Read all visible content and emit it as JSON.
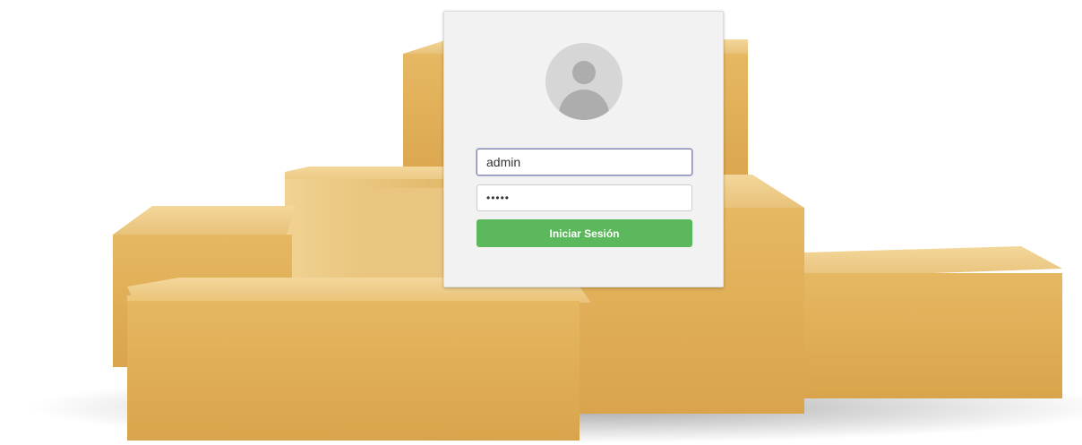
{
  "login": {
    "username_value": "admin",
    "password_value": "•••••",
    "submit_label": "Iniciar Sesión"
  },
  "colors": {
    "card_background": "#f2f2f2",
    "button_green": "#5cb85c",
    "box_cardboard": "#e0b35a",
    "avatar_fill": "#adadad"
  },
  "icons": {
    "avatar": "user-silhouette-icon"
  }
}
